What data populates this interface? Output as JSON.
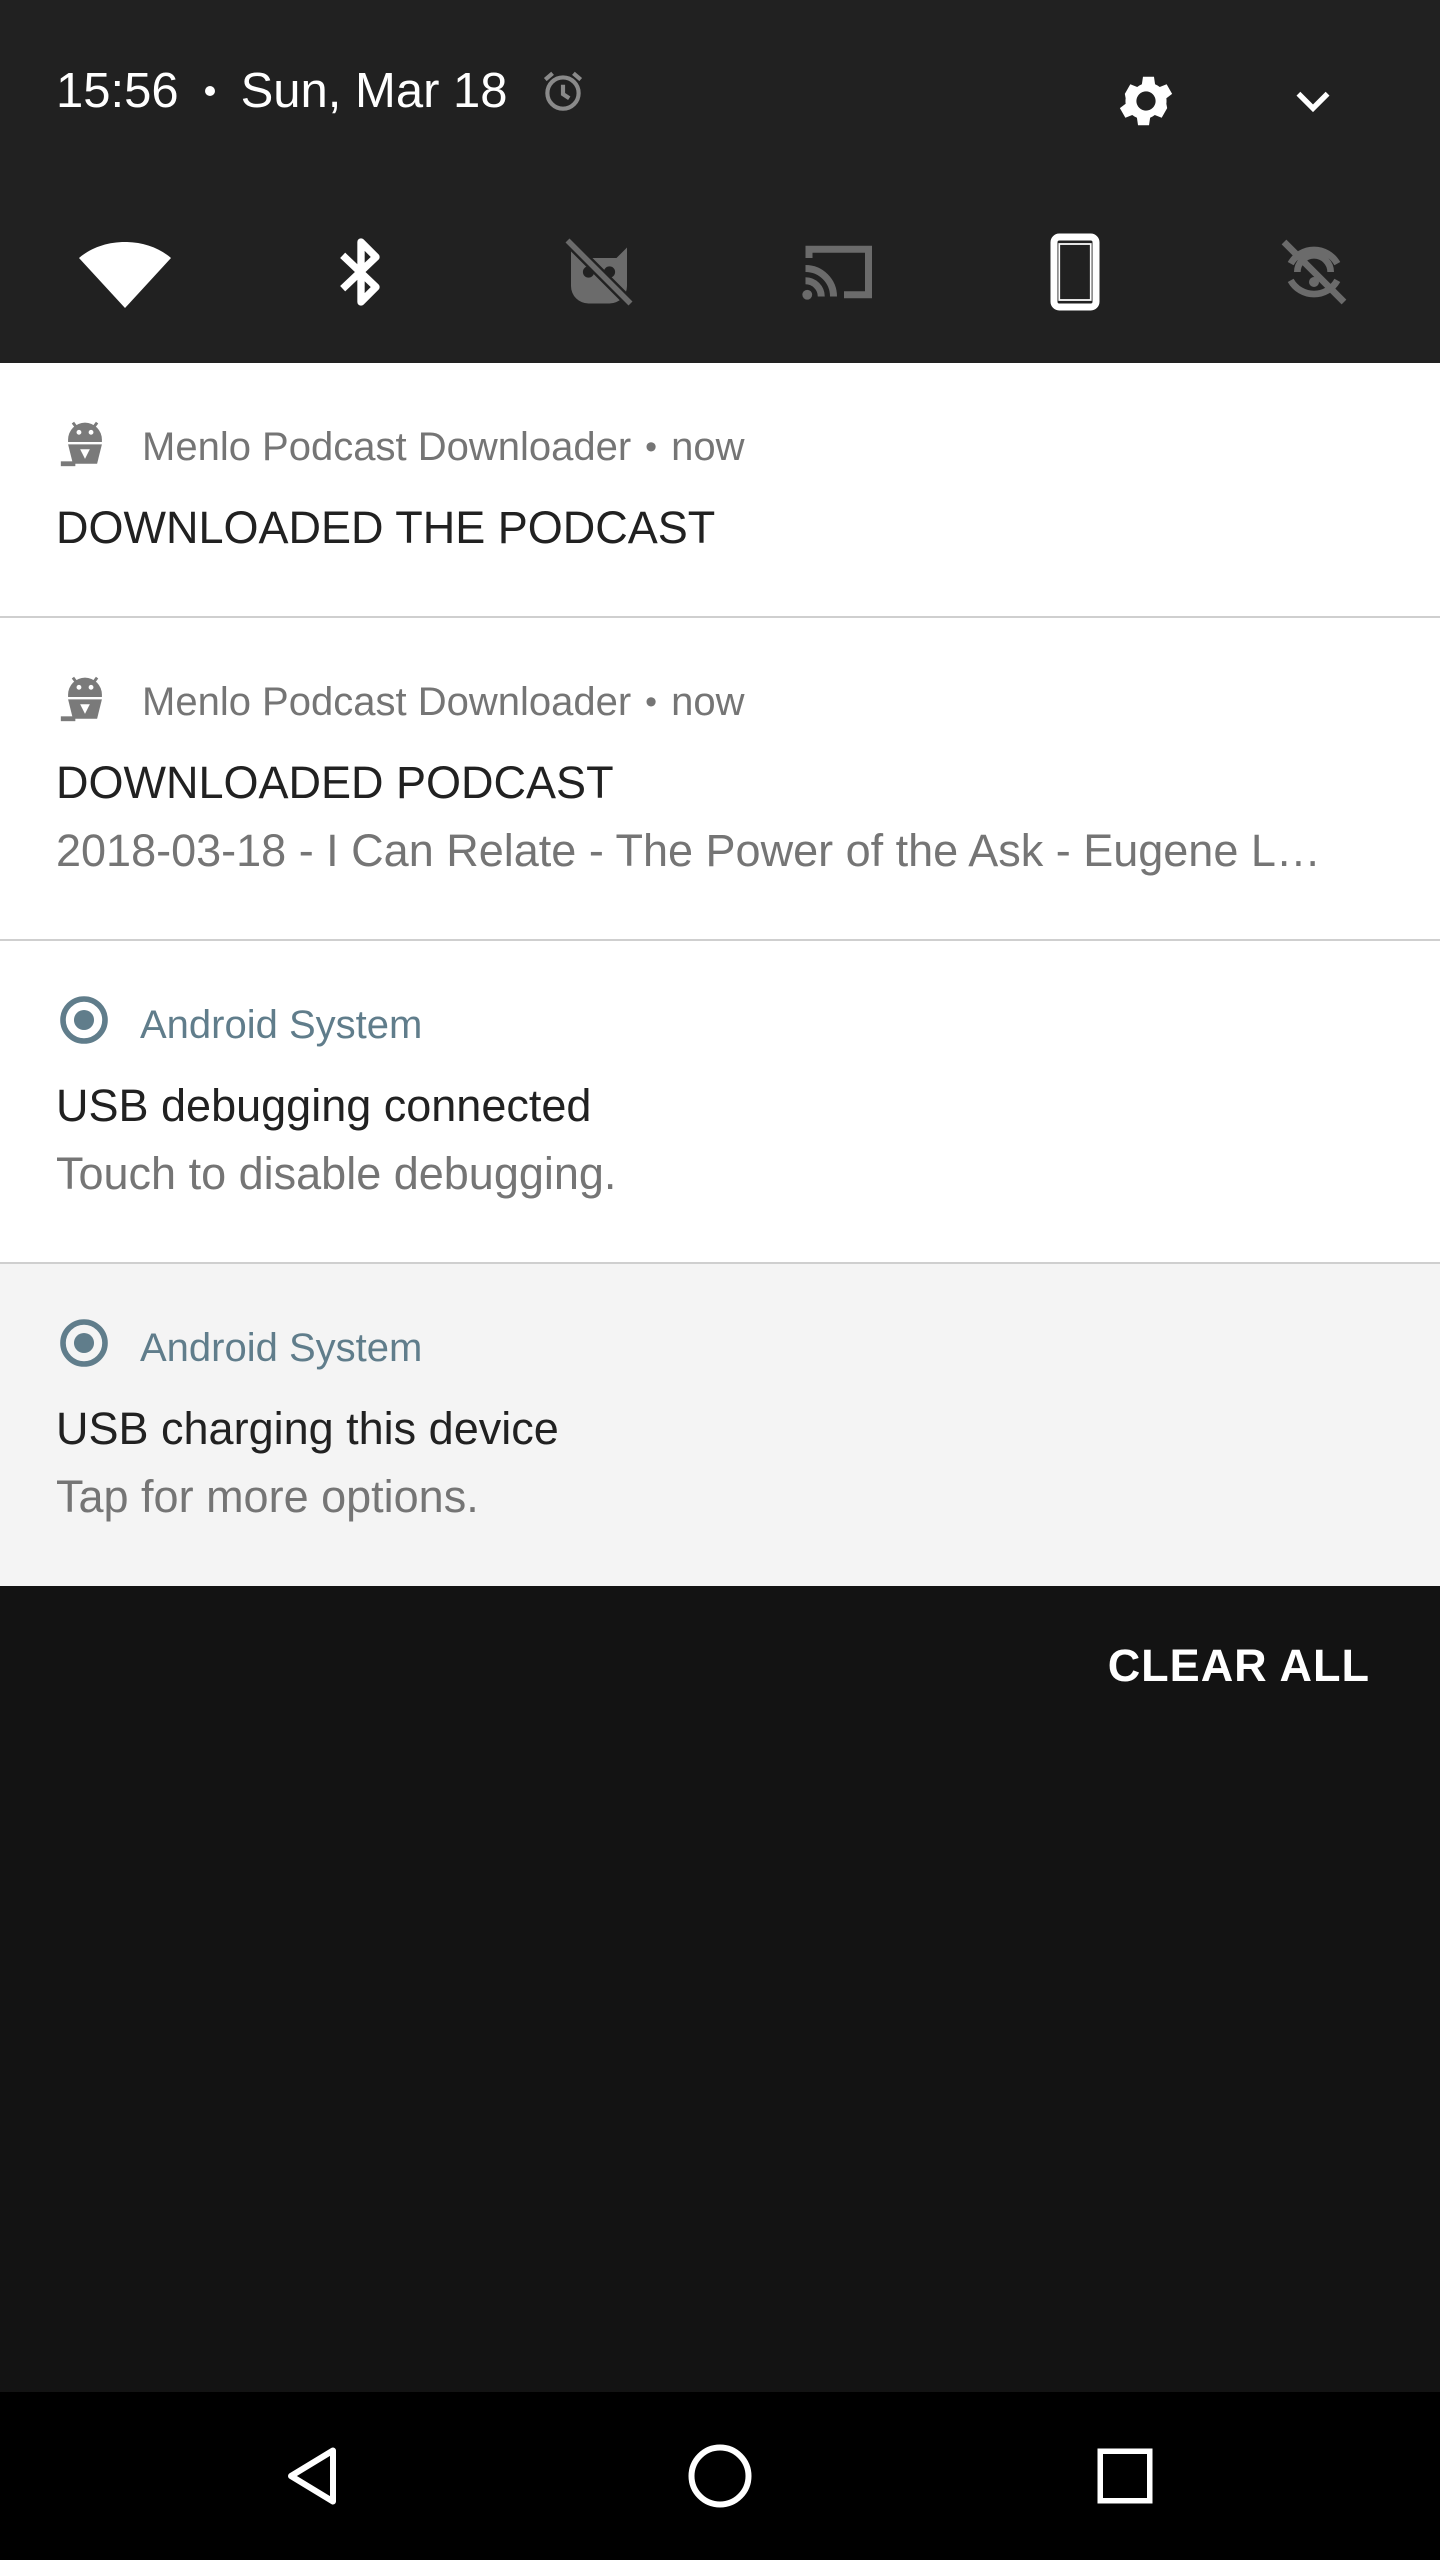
{
  "status": {
    "time": "15:56",
    "date": "Sun, Mar 18",
    "icons": [
      "alarm-icon",
      "settings-gear-icon",
      "expand-chevron-icon"
    ]
  },
  "quick_tiles": [
    {
      "name": "wifi-icon",
      "active": true
    },
    {
      "name": "bluetooth-icon",
      "active": true
    },
    {
      "name": "do-not-disturb-off-icon",
      "active": false
    },
    {
      "name": "cast-icon",
      "active": false
    },
    {
      "name": "portrait-rotation-icon",
      "active": true
    },
    {
      "name": "location-off-icon",
      "active": false
    }
  ],
  "notifications": [
    {
      "app": "Menlo Podcast Downloader",
      "time": "now",
      "title": "DOWNLOADED THE PODCAST",
      "icon": "android-app-icon"
    },
    {
      "app": "Menlo Podcast Downloader",
      "time": "now",
      "title": "DOWNLOADED PODCAST",
      "text": "2018-03-18 - I Can Relate - The Power of the Ask - Eugene L…",
      "icon": "android-app-icon"
    },
    {
      "app": "Android System",
      "title": "USB debugging connected",
      "text": "Touch to disable debugging.",
      "icon": "radio-target-icon"
    },
    {
      "app": "Android System",
      "title": "USB charging this device",
      "text": "Tap for more options.",
      "icon": "radio-target-icon"
    }
  ],
  "clear_all": "CLEAR ALL",
  "nav": [
    "back-icon",
    "home-icon",
    "recents-icon"
  ],
  "colors": {
    "header_bg": "#212121",
    "shade_bg": "#131313",
    "system_accent": "#607d8b",
    "card_bg": "#ffffff",
    "card_alt_bg": "#f4f4f4"
  }
}
